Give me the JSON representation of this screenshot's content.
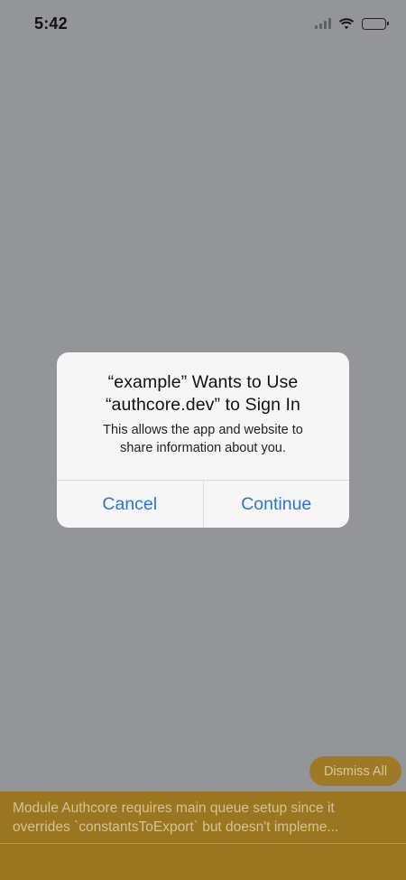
{
  "status_bar": {
    "time": "5:42"
  },
  "alert": {
    "title_line1": "“example” Wants to Use",
    "title_line2": "“authcore.dev” to Sign In",
    "message_line1": "This allows the app and website to",
    "message_line2": "share information about you.",
    "cancel_label": "Cancel",
    "continue_label": "Continue"
  },
  "dev_overlay": {
    "dismiss_all_label": "Dismiss All",
    "warning_line1": "Module Authcore requires main queue setup since it",
    "warning_line2": "overrides `constantsToExport` but doesn't impleme..."
  },
  "colors": {
    "background_dim": "#939598",
    "alert_bg": "#f6f6f7",
    "button_blue": "#2a73d9",
    "warning_bg": "#9a7620"
  }
}
